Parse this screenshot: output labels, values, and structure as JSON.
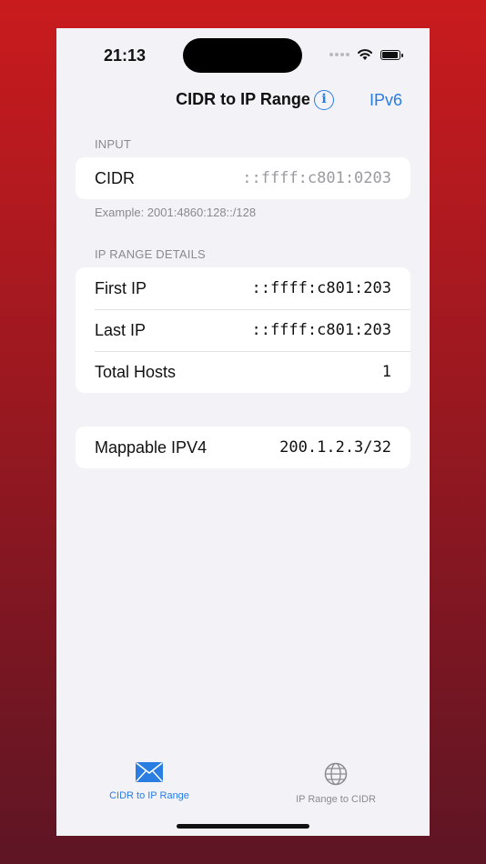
{
  "status_bar": {
    "time": "21:13"
  },
  "nav": {
    "title": "CIDR to IP Range",
    "info_icon": "info-circle-icon",
    "mode_button": "IPv6"
  },
  "input_section": {
    "header": "INPUT",
    "cidr_label": "CIDR",
    "cidr_placeholder": "::ffff:c801:0203",
    "example": "Example: 2001:4860:128::/128"
  },
  "details_section": {
    "header": "IP RANGE DETAILS",
    "rows": [
      {
        "label": "First IP",
        "value": "::ffff:c801:203"
      },
      {
        "label": "Last IP",
        "value": "::ffff:c801:203"
      },
      {
        "label": "Total Hosts",
        "value": "1"
      }
    ]
  },
  "mappable": {
    "label": "Mappable IPV4",
    "value": "200.1.2.3/32"
  },
  "tabs": [
    {
      "label": "CIDR to IP Range",
      "icon": "envelope-icon",
      "active": true
    },
    {
      "label": "IP Range to CIDR",
      "icon": "globe-icon",
      "active": false
    }
  ],
  "colors": {
    "accent": "#2a7de1",
    "background": "#f2f2f7"
  }
}
